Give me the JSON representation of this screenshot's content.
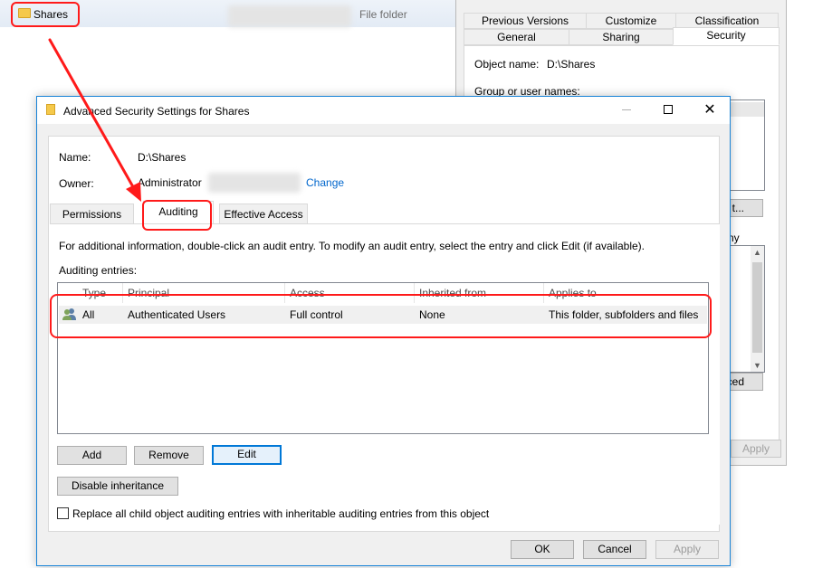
{
  "explorer": {
    "folder_name": "Shares",
    "item_type": "File folder"
  },
  "properties": {
    "tabs_row1": [
      "Previous Versions",
      "Customize",
      "Classification"
    ],
    "tabs_row2": [
      "General",
      "Sharing",
      "Security"
    ],
    "active_tab": "Security",
    "object_name_label": "Object name:",
    "object_name_value": "D:\\Shares",
    "group_label": "Group or user names:",
    "partial_edit": "t...",
    "partial_permissions": "ny",
    "partial_advanced": "ced",
    "apply_label": "Apply"
  },
  "dialog": {
    "title": "Advanced Security Settings for Shares",
    "name_label": "Name:",
    "name_value": "D:\\Shares",
    "owner_label": "Owner:",
    "owner_value": "Administrator",
    "change_link": "Change",
    "tabs": [
      "Permissions",
      "Auditing",
      "Effective Access"
    ],
    "active_tab": "Auditing",
    "info_text": "For additional information, double-click an audit entry. To modify an audit entry, select the entry and click Edit (if available).",
    "entries_label": "Auditing entries:",
    "columns": [
      "Type",
      "Principal",
      "Access",
      "Inherited from",
      "Applies to"
    ],
    "rows": [
      {
        "type": "All",
        "principal": "Authenticated Users",
        "access": "Full control",
        "inherited_from": "None",
        "applies_to": "This folder, subfolders and files"
      }
    ],
    "add_label": "Add",
    "remove_label": "Remove",
    "edit_label": "Edit",
    "disable_inheritance_label": "Disable inheritance",
    "replace_label": "Replace all child object auditing entries with inheritable auditing entries from this object",
    "ok_label": "OK",
    "cancel_label": "Cancel",
    "apply_label": "Apply"
  },
  "colors": {
    "accent": "#0078d7",
    "annotation": "#ff1a1a",
    "link": "#0066cc"
  }
}
